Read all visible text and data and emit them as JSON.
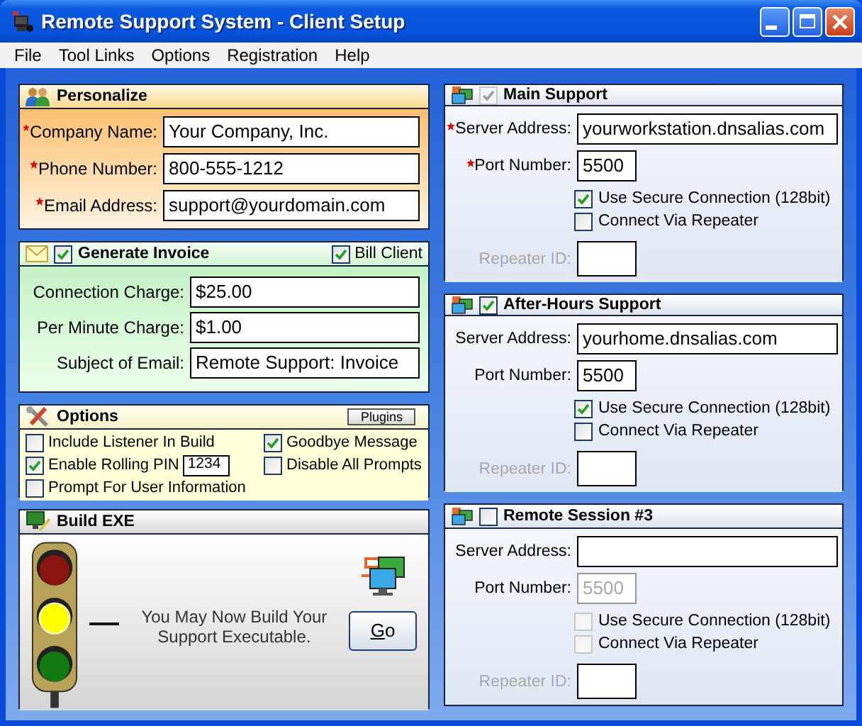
{
  "window": {
    "title": "Remote Support System - Client Setup"
  },
  "menu": [
    "File",
    "Tool Links",
    "Options",
    "Registration",
    "Help"
  ],
  "personalize": {
    "title": "Personalize",
    "fields": [
      {
        "label": "Company Name:",
        "required": true,
        "value": "Your Company, Inc."
      },
      {
        "label": "Phone Number:",
        "required": true,
        "value": "800-555-1212"
      },
      {
        "label": "Email Address:",
        "required": true,
        "value": "support@yourdomain.com"
      }
    ]
  },
  "invoice": {
    "title": "Generate Invoice",
    "checked": true,
    "bill_client": {
      "label": "Bill Client",
      "checked": true
    },
    "fields": [
      {
        "label": "Connection Charge:",
        "value": "$25.00"
      },
      {
        "label": "Per Minute Charge:",
        "value": "$1.00"
      },
      {
        "label": "Subject of Email:",
        "value": "Remote Support: Invoice"
      }
    ]
  },
  "options": {
    "title": "Options",
    "plugins_button": "Plugins",
    "columns": [
      [
        {
          "kind": "checkbox",
          "label": "Include Listener In Build",
          "checked": false
        },
        {
          "kind": "pin",
          "label": "Enable Rolling PIN",
          "checked": true,
          "value": "1234"
        },
        {
          "kind": "checkbox",
          "label": "Prompt For User Information",
          "checked": false
        }
      ],
      [
        {
          "kind": "checkbox",
          "label": "Goodbye Message",
          "checked": true
        },
        {
          "kind": "checkbox",
          "label": "Disable All Prompts",
          "checked": false
        }
      ]
    ]
  },
  "build": {
    "title": "Build EXE",
    "lights": [
      {
        "color": "#8a1410",
        "on": false
      },
      {
        "color": "#ffff00",
        "on": true
      },
      {
        "color": "#137a13",
        "on": false
      }
    ],
    "message": "You May Now Build Your Support Executable.",
    "go_button": "Go"
  },
  "sessions": [
    {
      "title": "Main Support",
      "checked": true,
      "check_disabled": true,
      "server": {
        "label": "Server Address:",
        "required": true,
        "value": "yourworkstation.dnsalias.com"
      },
      "port": {
        "label": "Port Number:",
        "required": true,
        "value": "5500",
        "disabled": false
      },
      "secure": {
        "label": "Use Secure Connection (128bit)",
        "checked": true,
        "disabled": false
      },
      "repeater": {
        "label": "Connect Via Repeater",
        "checked": false,
        "disabled": false
      },
      "repeater_id": {
        "label": "Repeater ID:",
        "disabled": true
      }
    },
    {
      "title": "After-Hours Support",
      "checked": true,
      "check_disabled": false,
      "server": {
        "label": "Server Address:",
        "required": false,
        "value": "yourhome.dnsalias.com"
      },
      "port": {
        "label": "Port Number:",
        "required": false,
        "value": "5500",
        "disabled": false
      },
      "secure": {
        "label": "Use Secure Connection (128bit)",
        "checked": true,
        "disabled": false
      },
      "repeater": {
        "label": "Connect Via Repeater",
        "checked": false,
        "disabled": false
      },
      "repeater_id": {
        "label": "Repeater ID:",
        "disabled": true
      }
    },
    {
      "title": "Remote Session #3",
      "checked": false,
      "check_disabled": false,
      "server": {
        "label": "Server Address:",
        "required": false
      },
      "port": {
        "label": "Port Number:",
        "required": false,
        "value": "5500",
        "disabled": true
      },
      "secure": {
        "label": "Use Secure Connection (128bit)",
        "checked": false,
        "disabled": true
      },
      "repeater": {
        "label": "Connect Via Repeater",
        "checked": false,
        "disabled": true
      },
      "repeater_id": {
        "label": "Repeater ID:",
        "disabled": true
      }
    }
  ]
}
